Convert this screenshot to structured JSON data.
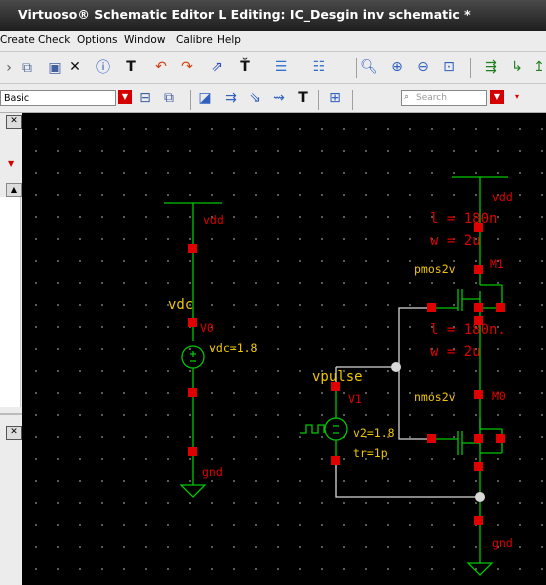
{
  "title": "Virtuoso® Schematic Editor L Editing: IC_Desgin inv schematic *",
  "menu": [
    "Create",
    "Check",
    "Options",
    "Window",
    "Calibre",
    "Help"
  ],
  "toolbar2": {
    "basic": "Basic",
    "search_placeholder": "Search"
  },
  "colors": {
    "wire": "#00c800",
    "pin": "#e00000",
    "label": "#f0c800",
    "net_label": "#e00000",
    "selected_wire": "#ffffff"
  },
  "schematic": {
    "vdc": {
      "name": "vdc",
      "inst": "V0",
      "param": "vdc=1.8",
      "top_net": "vdd",
      "bottom_net": "gnd"
    },
    "vpulse": {
      "name": "vpulse",
      "inst": "V1",
      "param1": "v2=1.8",
      "param2": "tr=1p"
    },
    "pmos": {
      "l": "l = 180n",
      "w": "w = 2u",
      "model": "pmos2v",
      "inst": "M1",
      "top_net": "vdd"
    },
    "nmos": {
      "l": "l = 180n.",
      "w": "w = 2u",
      "model": "nmos2v",
      "inst": "M0",
      "bottom_net": "gnd"
    }
  }
}
